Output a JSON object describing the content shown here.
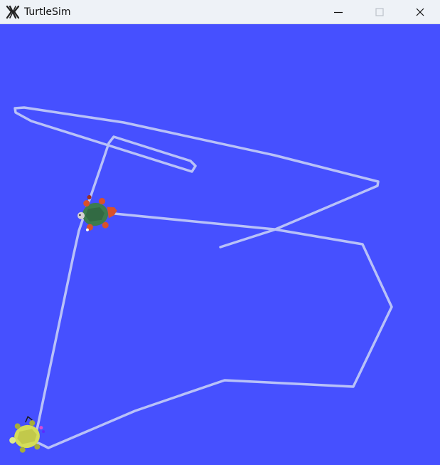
{
  "window": {
    "title": "TurtleSim",
    "app_icon": "x-logo-icon",
    "controls": [
      {
        "name": "minimize-button",
        "icon": "minimize-icon"
      },
      {
        "name": "maximize-button",
        "icon": "maximize-icon",
        "disabled": true
      },
      {
        "name": "close-button",
        "icon": "close-icon"
      }
    ]
  },
  "canvas": {
    "background_color": "#4650ff",
    "pen_color": "#b8c1f8",
    "turtles": [
      {
        "name": "turtle-green-red",
        "shell_color": "#3c7c4e",
        "accent_color": "#d9512a"
      },
      {
        "name": "turtle-yellow",
        "shell_color": "#d4dd59",
        "accent_color": "#9a9f2f"
      }
    ]
  }
}
